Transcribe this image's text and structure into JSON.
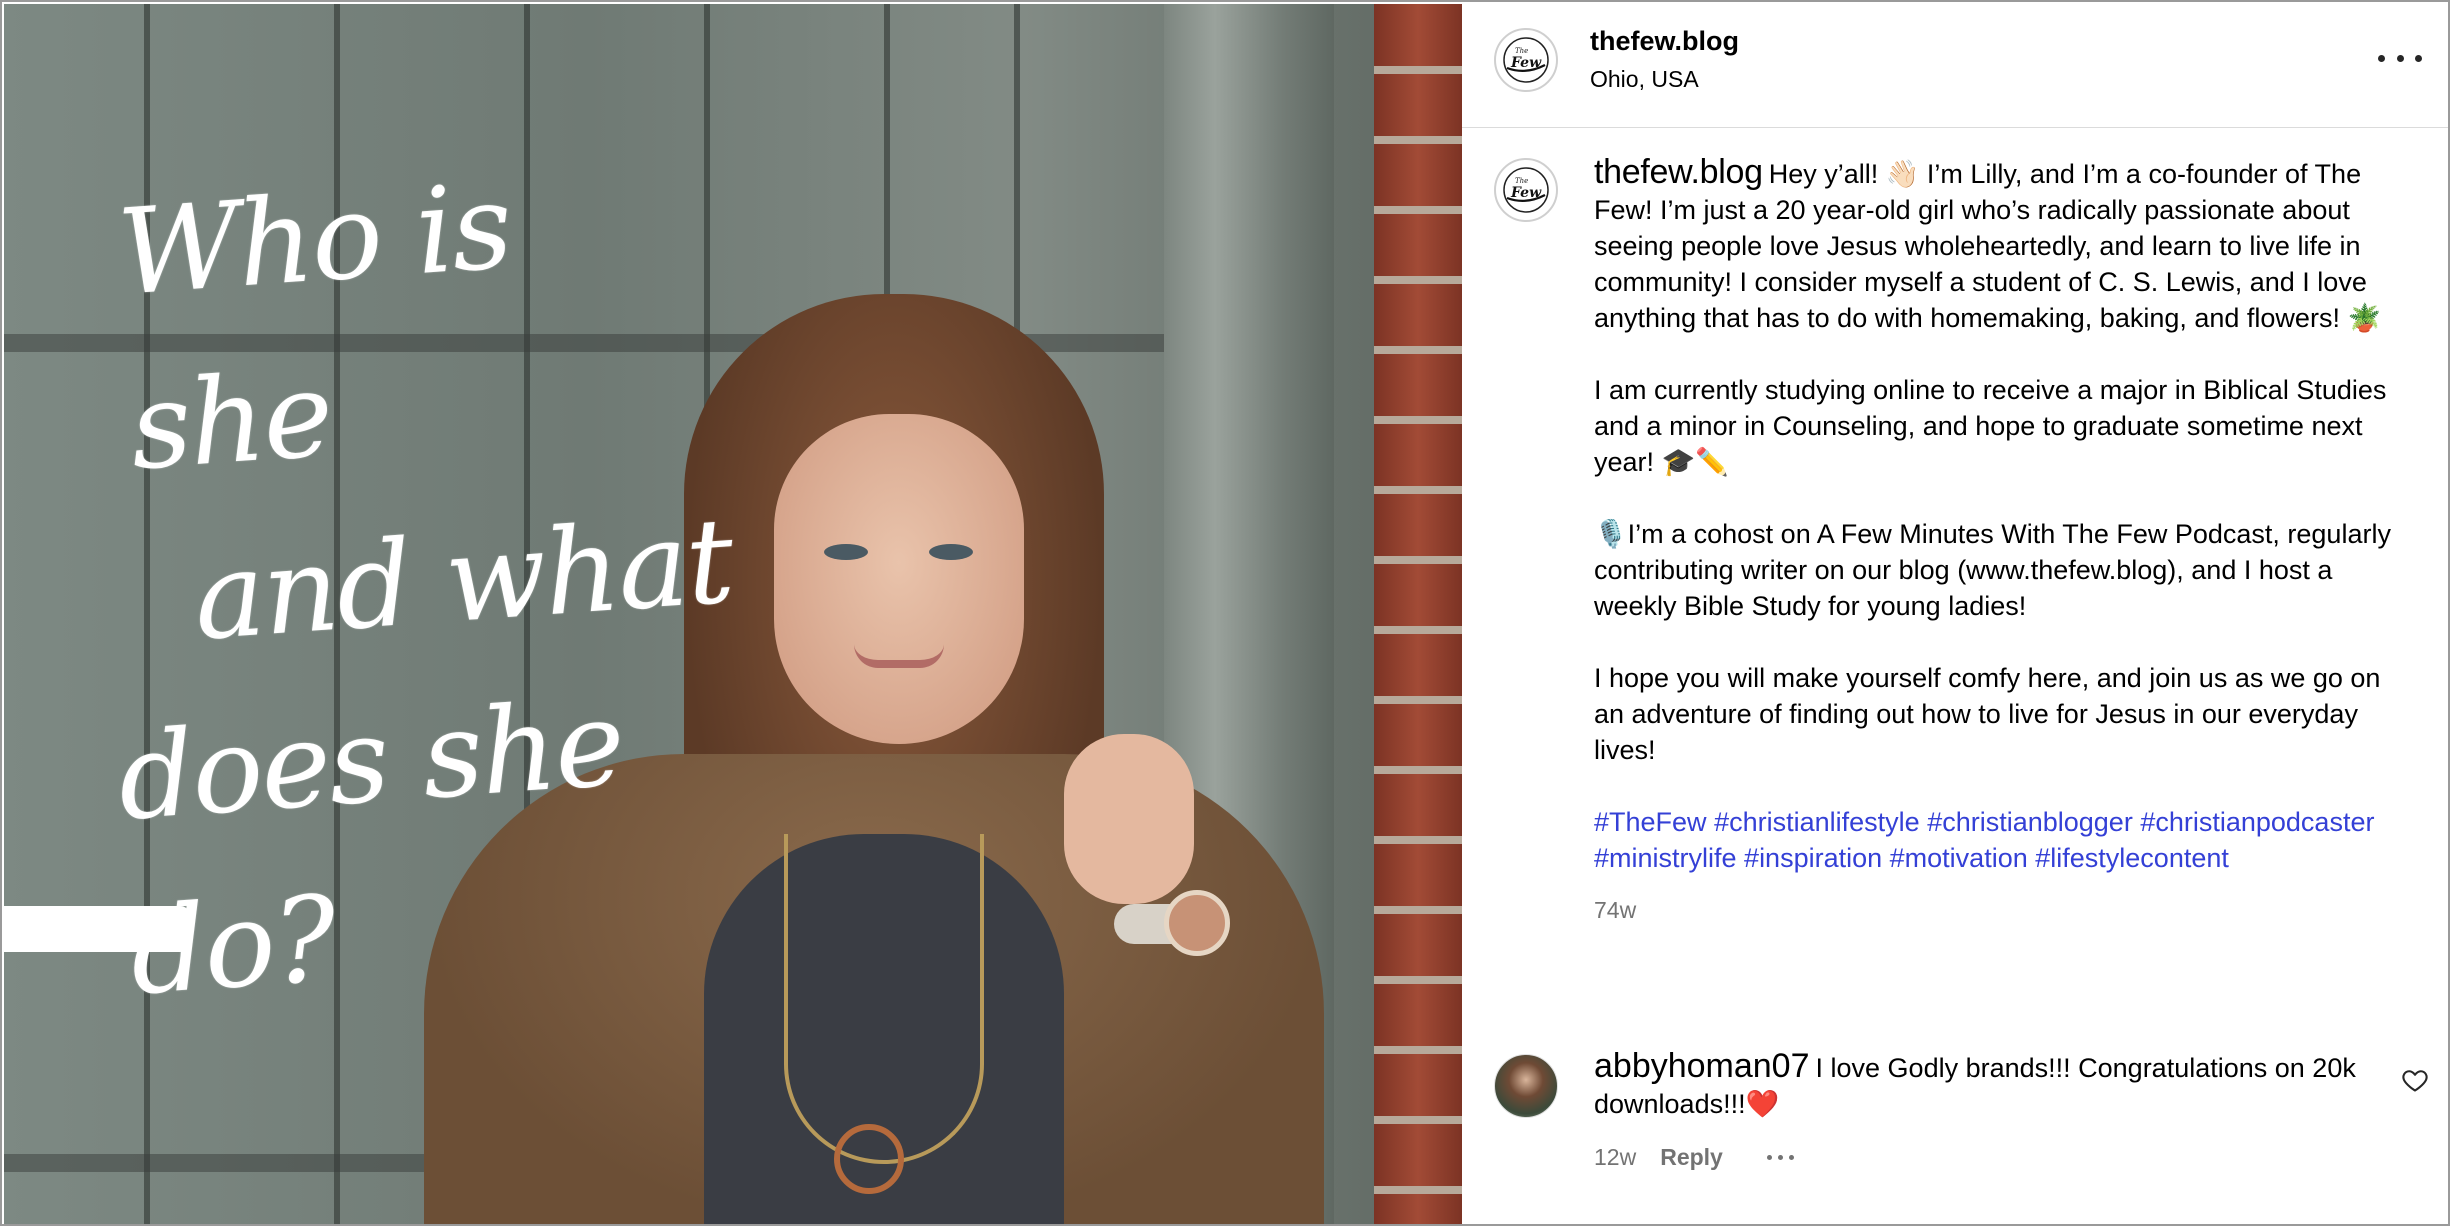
{
  "post": {
    "username": "thefew.blog",
    "location": "Ohio, USA",
    "image_text": {
      "line1": "Who is she",
      "line2": "and what",
      "line3": "does she do?"
    }
  },
  "caption": {
    "username": "thefew.blog",
    "paragraph1": "Hey y’all! 👋🏻 I’m Lilly, and I’m a co-founder of The Few! I’m just a 20 year-old girl who’s radically passionate about seeing people love Jesus wholeheartedly, and learn to live life in community! I consider myself a student of C. S. Lewis, and I love anything that has to do with homemaking, baking, and flowers! 🪴",
    "paragraph2": "I am currently studying online to receive a major in Biblical Studies and a minor in Counseling, and hope to graduate sometime next year! 🎓✏️",
    "paragraph3": "🎙️I’m a cohost on A Few Minutes With The Few Podcast, regularly contributing writer on our blog (www.thefew.blog), and I host a weekly Bible Study for young ladies!",
    "paragraph4": "I hope you will make yourself comfy here, and join us as we go on an adventure of finding out how to live for Jesus in our everyday lives!",
    "hashtags": [
      "#TheFew",
      "#christianlifestyle",
      "#christianblogger",
      "#christianpodcaster",
      "#ministrylife",
      "#inspiration",
      "#motivation",
      "#lifestylecontent"
    ],
    "age": "74w"
  },
  "comment": {
    "username": "abbyhoman07",
    "text": "I love Godly brands!!! Congratulations on 20k downloads!!!❤️",
    "age": "12w",
    "reply_label": "Reply"
  },
  "icons": {
    "more": "more-horizontal-icon",
    "heart": "heart-outline-icon",
    "avatar": "the-few-logo"
  },
  "colors": {
    "hashtag": "#3440d6",
    "muted": "#737373",
    "divider": "#dbdbdb"
  }
}
